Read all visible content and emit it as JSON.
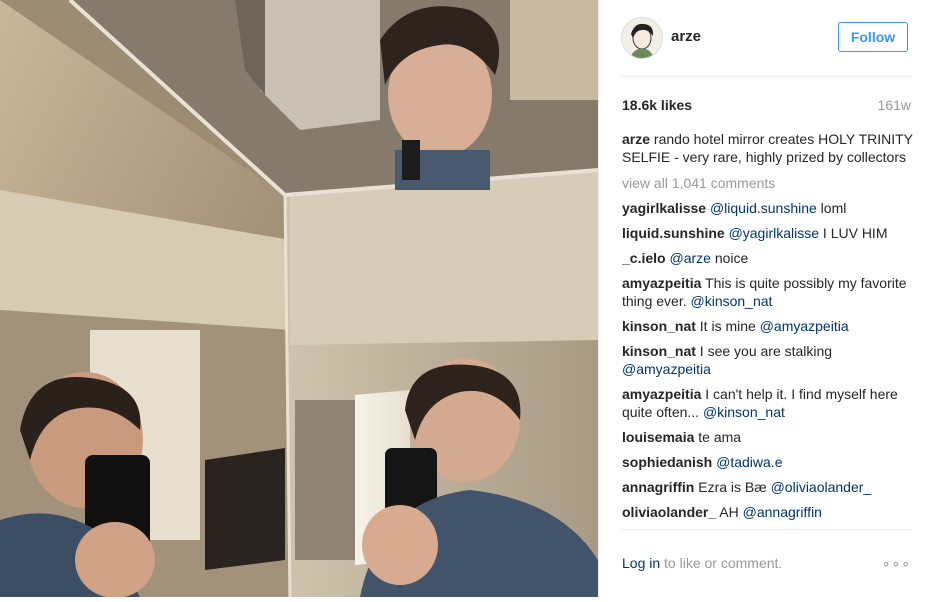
{
  "post": {
    "username": "arze",
    "follow_label": "Follow",
    "likes": "18.6k likes",
    "time_ago": "161w",
    "caption_user": "arze",
    "caption_text": "rando hotel mirror creates HOLY TRINITY SELFIE - very rare, highly prized by collectors",
    "view_all": "view all 1,041 comments",
    "comments": [
      {
        "user": "yagirlkalisse",
        "mention": "@liquid.sunshine",
        "text": " loml"
      },
      {
        "user": "liquid.sunshine",
        "mention": "@yagirlkalisse",
        "text": " I LUV HIM"
      },
      {
        "user": "_c.ielo",
        "mention": "@arze",
        "text": " noice"
      },
      {
        "user": "amyazpeitia",
        "text": "This is quite possibly my favorite thing ever. ",
        "mention_after": "@kinson_nat"
      },
      {
        "user": "kinson_nat",
        "text": "It is mine ",
        "mention_after": "@amyazpeitia"
      },
      {
        "user": "kinson_nat",
        "text": "I see you are stalking ",
        "mention_after": "@amyazpeitia"
      },
      {
        "user": "amyazpeitia",
        "text": "I can't help it. I find myself here quite often... ",
        "mention_after": "@kinson_nat"
      },
      {
        "user": "louisemaia",
        "text": "te ama"
      },
      {
        "user": "sophiedanish",
        "mention": "@tadiwa.e",
        "text": ""
      },
      {
        "user": "annagriffin",
        "text": "Ezra is Bæ ",
        "mention_after": "@oliviaolander_"
      },
      {
        "user": "oliviaolander_",
        "text": "AH ",
        "mention_after": "@annagriffin"
      }
    ],
    "login_link": "Log in",
    "login_text": " to like or comment.",
    "more_dots": "∘∘∘"
  }
}
